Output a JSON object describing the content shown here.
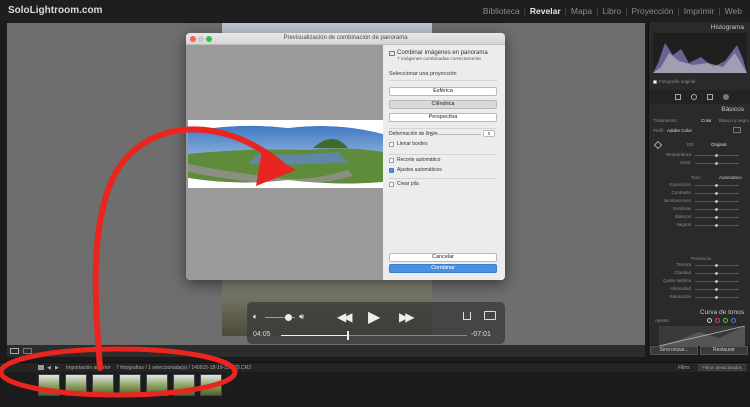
{
  "app": {
    "logo": "SoloLightroom.com",
    "modules": [
      "Biblioteca",
      "Revelar",
      "Mapa",
      "Libro",
      "Proyección",
      "Imprimir",
      "Web"
    ],
    "active_module": "Revelar"
  },
  "dialog": {
    "title": "Previsualización de combinación de panorama",
    "heading": "Combinar imágenes en panorama",
    "subheading": "7 imágenes combinadas correctamente",
    "projection_label": "Seleccionar una proyección",
    "projections": [
      "Esférica",
      "Cilíndrica",
      "Perspectiva"
    ],
    "selected_projection": "Cilíndrica",
    "boundary_warp_label": "Deformación de límite",
    "boundary_warp_value": "0",
    "fill_edges_label": "Llenar bordes",
    "auto_crop_label": "Recorte automático",
    "auto_settings_label": "Ajustes automáticos",
    "create_stack_label": "Crear pila",
    "cancel_label": "Cancelar",
    "merge_label": "Combinar"
  },
  "right_panel": {
    "histogram_label": "Histograma",
    "original_photo_label": "Fotografía original",
    "basic_label": "Básicos",
    "treatment_label": "Tratamiento:",
    "color_label": "Color",
    "bw_label": "Blanco y negro",
    "profile_label": "Perfil:",
    "profile_value": "Adobe Color",
    "wb_label": "EB:",
    "wb_value": "Original",
    "tone_label": "Tono",
    "auto_label": "Automático",
    "presence_label": "Presencia",
    "tone_curve_label": "Curva de tonos",
    "sliders": [
      "Temperatura",
      "Matiz",
      "Exposición",
      "Contraste",
      "Iluminaciones",
      "Sombras",
      "Blancos",
      "Negros",
      "Textura",
      "Claridad",
      "Quitar neblina",
      "Intensidad",
      "Saturación"
    ],
    "sync_label": "Sincronizar...",
    "reset_label": "Restaurar",
    "adjust_label": "Ajustar"
  },
  "filmstrip": {
    "info": "Importación anterior    7 fotografías / 1 seleccionada(s) / 140915-18-19-19-020.CR2",
    "filter_label": "Filtro:",
    "filter_value": "Filtros desactivados",
    "thumb_count": 7
  },
  "video": {
    "current_time": "04:05",
    "remaining_time": "-07:01",
    "volume_level": 0.75,
    "progress": 0.36
  },
  "colors": {
    "annotation_red": "#e8261f",
    "accent_blue": "#4a90e2"
  }
}
